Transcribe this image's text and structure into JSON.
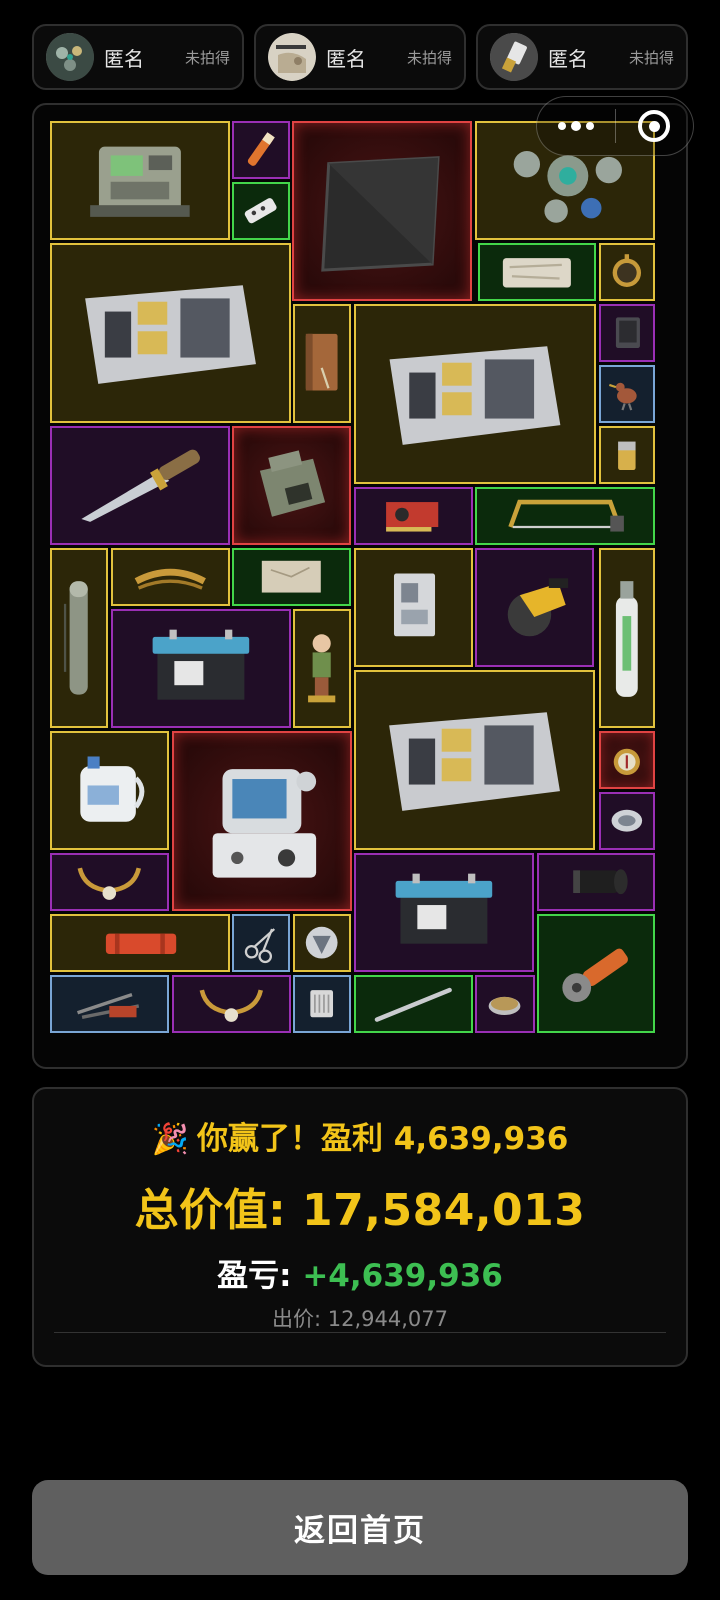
{
  "players": [
    {
      "name": "匿名",
      "status": "未拍得",
      "avatar_icon": "ornament-avatar-icon"
    },
    {
      "name": "匿名",
      "status": "未拍得",
      "avatar_icon": "painting-avatar-icon"
    },
    {
      "name": "匿名",
      "status": "未拍得",
      "avatar_icon": "usb-drive-avatar-icon"
    }
  ],
  "capsule": {
    "more_icon": "more-dots-icon",
    "close_icon": "target-close-icon"
  },
  "quality_colors": {
    "gold": "#e2c23d",
    "purple": "#9a2fb5",
    "green": "#43d64a",
    "red": "#e04343",
    "blue": "#7aa6d6"
  },
  "grid_items": [
    {
      "id": "item-military-radio-station",
      "icon": "radio-station-icon",
      "quality": "gold"
    },
    {
      "id": "item-flare",
      "icon": "flare-icon",
      "quality": "purple"
    },
    {
      "id": "item-carbon-plate",
      "icon": "carbon-plate-icon",
      "quality": "red"
    },
    {
      "id": "item-jeweled-ornament",
      "icon": "jeweled-ornament-icon",
      "quality": "gold"
    },
    {
      "id": "item-power-strip",
      "icon": "power-strip-icon",
      "quality": "green"
    },
    {
      "id": "item-server-1",
      "icon": "server-icon",
      "quality": "gold"
    },
    {
      "id": "item-cloth-map",
      "icon": "cloth-map-icon",
      "quality": "green"
    },
    {
      "id": "item-pocket-watch",
      "icon": "pocket-watch-icon",
      "quality": "gold"
    },
    {
      "id": "item-leather-notebook",
      "icon": "leather-notebook-icon",
      "quality": "gold"
    },
    {
      "id": "item-server-2",
      "icon": "server-icon",
      "quality": "gold"
    },
    {
      "id": "item-tablet",
      "icon": "tablet-icon",
      "quality": "purple"
    },
    {
      "id": "item-bird-figurine",
      "icon": "bird-figurine-icon",
      "quality": "blue"
    },
    {
      "id": "item-combat-knife",
      "icon": "knife-icon",
      "quality": "purple"
    },
    {
      "id": "item-field-radio",
      "icon": "field-radio-icon",
      "quality": "red"
    },
    {
      "id": "item-lighter",
      "icon": "lighter-icon",
      "quality": "gold"
    },
    {
      "id": "item-graphics-card",
      "icon": "graphics-card-icon",
      "quality": "purple"
    },
    {
      "id": "item-hacksaw",
      "icon": "hacksaw-icon",
      "quality": "green"
    },
    {
      "id": "item-tube-case",
      "icon": "tube-case-icon",
      "quality": "gold"
    },
    {
      "id": "item-gold-laurel",
      "icon": "gold-laurel-icon",
      "quality": "gold"
    },
    {
      "id": "item-old-map",
      "icon": "old-map-icon",
      "quality": "green"
    },
    {
      "id": "item-id-document",
      "icon": "id-document-icon",
      "quality": "gold"
    },
    {
      "id": "item-circular-saw",
      "icon": "circular-saw-icon",
      "quality": "purple"
    },
    {
      "id": "item-oxygen-tank",
      "icon": "oxygen-tank-icon",
      "quality": "gold"
    },
    {
      "id": "item-car-battery-1",
      "icon": "car-battery-icon",
      "quality": "purple"
    },
    {
      "id": "item-boy-figurine",
      "icon": "boy-figurine-icon",
      "quality": "gold"
    },
    {
      "id": "item-server-3",
      "icon": "server-icon",
      "quality": "gold"
    },
    {
      "id": "item-chemical-jug",
      "icon": "chemical-jug-icon",
      "quality": "gold"
    },
    {
      "id": "item-medical-monitor",
      "icon": "medical-monitor-icon",
      "quality": "red"
    },
    {
      "id": "item-compass",
      "icon": "compass-icon",
      "quality": "red"
    },
    {
      "id": "item-ornate-brooch",
      "icon": "ornate-brooch-icon",
      "quality": "purple"
    },
    {
      "id": "item-horned-necklace-1",
      "icon": "horned-necklace-icon",
      "quality": "purple"
    },
    {
      "id": "item-car-battery-2",
      "icon": "car-battery-icon",
      "quality": "purple"
    },
    {
      "id": "item-camera-lens",
      "icon": "camera-lens-icon",
      "quality": "purple"
    },
    {
      "id": "item-red-case",
      "icon": "red-case-icon",
      "quality": "gold"
    },
    {
      "id": "item-scissors",
      "icon": "scissors-icon",
      "quality": "blue"
    },
    {
      "id": "item-emblem-coin",
      "icon": "emblem-coin-icon",
      "quality": "gold"
    },
    {
      "id": "item-angle-grinder",
      "icon": "angle-grinder-icon",
      "quality": "green"
    },
    {
      "id": "item-tool-kit",
      "icon": "tool-kit-icon",
      "quality": "blue"
    },
    {
      "id": "item-horned-necklace-2",
      "icon": "horned-necklace-icon",
      "quality": "purple"
    },
    {
      "id": "item-filter-cartridge",
      "icon": "filter-cartridge-icon",
      "quality": "blue"
    },
    {
      "id": "item-metal-rod",
      "icon": "metal-rod-icon",
      "quality": "green"
    },
    {
      "id": "item-petri-dish",
      "icon": "petri-dish-icon",
      "quality": "purple"
    }
  ],
  "result": {
    "party_icon": "🎉",
    "win_text": "你赢了！盈利 4,639,936",
    "total_label": "总价值: ",
    "total_value": "17,584,013",
    "pl_label": "盈亏: ",
    "pl_value": "+4,639,936",
    "price_text": "出价: 12,944,077",
    "accent_color": "#f2c419",
    "profit_color": "#3dbf52"
  },
  "home_button": {
    "label": "返回首页"
  }
}
